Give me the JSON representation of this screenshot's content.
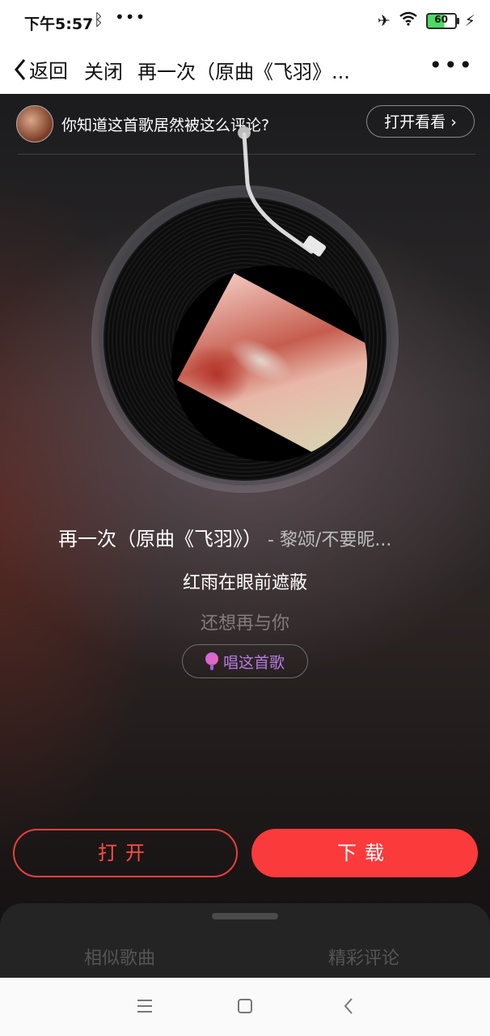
{
  "status": {
    "time": "下午5:57",
    "battery": "60"
  },
  "nav": {
    "back_label": "返回",
    "close_label": "关闭",
    "title": "再一次（原曲《飞羽》..."
  },
  "promo": {
    "text": "你知道这首歌居然被这么评论?",
    "button": "打开看看 ›"
  },
  "song": {
    "title": "再一次（原曲《飞羽》）",
    "artist": " - 黎颂/不要昵..."
  },
  "lyrics": {
    "current": "红雨在眼前遮蔽",
    "next": "还想再与你"
  },
  "sing_button": "唱这首歌",
  "actions": {
    "open": "打开",
    "download": "下载"
  },
  "tabs": {
    "similar": "相似歌曲",
    "comments": "精彩评论"
  },
  "colors": {
    "accent": "#fb3a3b",
    "sing": "#b77be0"
  }
}
